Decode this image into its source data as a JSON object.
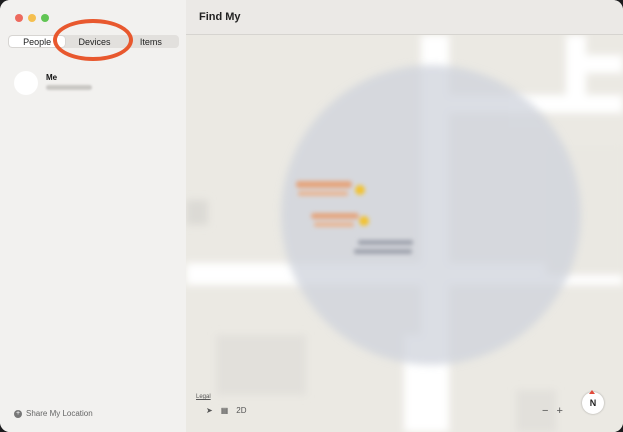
{
  "window": {
    "title": "Find My"
  },
  "sidebar": {
    "tabs": [
      {
        "label": "People",
        "active": true
      },
      {
        "label": "Devices",
        "active": false
      },
      {
        "label": "Items",
        "active": false
      }
    ],
    "me": {
      "name": "Me"
    },
    "share_location": "Share My Location"
  },
  "map": {
    "legal": "Legal",
    "view_mode": "2D",
    "zoom_out": "−",
    "zoom_in": "+",
    "compass": "N"
  },
  "colors": {
    "annotation": "#e8582e",
    "location_pin": "#f2c230"
  },
  "icons": [
    "location-arrow-icon",
    "map-icon",
    "compass-icon",
    "plus-circle-icon"
  ]
}
